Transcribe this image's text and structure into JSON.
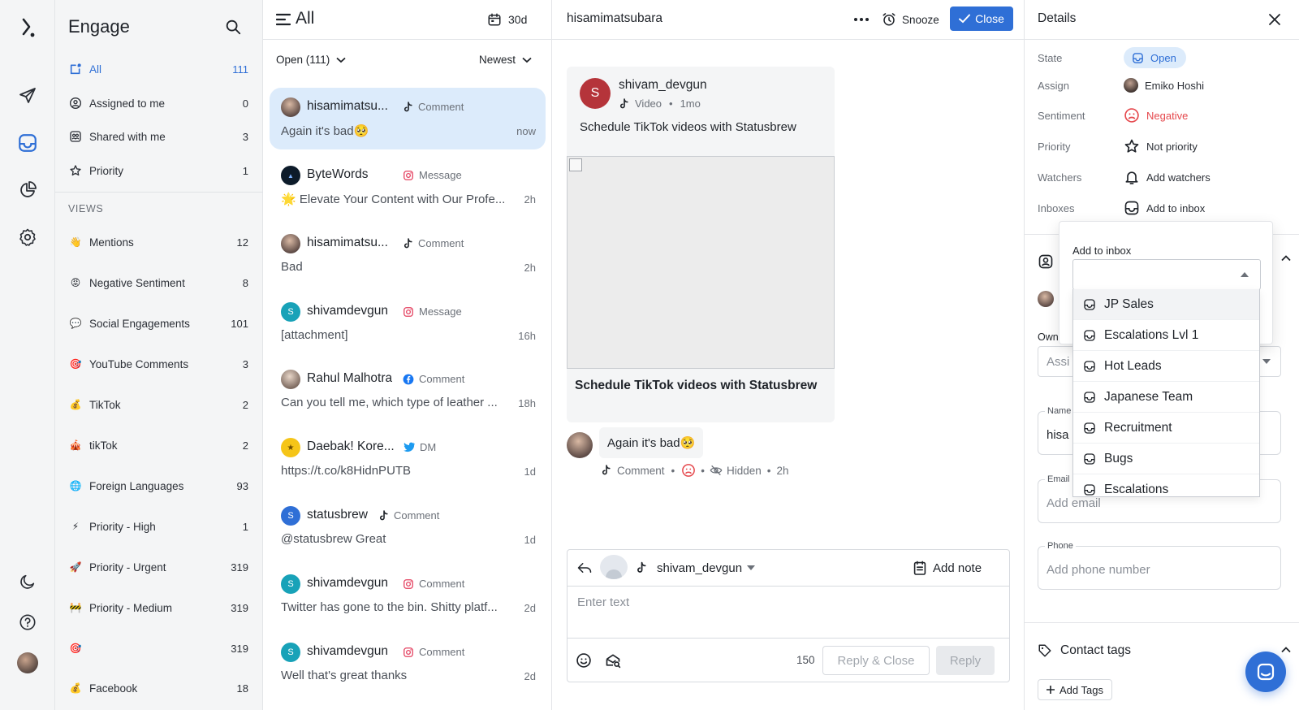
{
  "colors": {
    "accent": "#2f6fd6",
    "negative": "#e5484d",
    "open_bg": "#dcebfb"
  },
  "engage": {
    "title": "Engage",
    "items": [
      {
        "label": "All",
        "count": "111",
        "icon": "all-inbox-icon",
        "active": true
      },
      {
        "label": "Assigned to me",
        "count": "0",
        "icon": "user-circle-icon"
      },
      {
        "label": "Shared with me",
        "count": "3",
        "icon": "shared-icon"
      },
      {
        "label": "Priority",
        "count": "1",
        "icon": "star-icon"
      }
    ],
    "views_heading": "VIEWS",
    "views": [
      {
        "emoji": "👋",
        "label": "Mentions",
        "count": "12"
      },
      {
        "emoji": "😡",
        "label": "Negative Sentiment",
        "count": "8"
      },
      {
        "emoji": "💬",
        "label": "Social Engagements",
        "count": "101"
      },
      {
        "emoji": "🎯",
        "label": "YouTube Comments",
        "count": "3"
      },
      {
        "emoji": "💰",
        "label": "TikTok",
        "count": "2"
      },
      {
        "emoji": "🎪",
        "label": "tikTok",
        "count": "2"
      },
      {
        "emoji": "🌐",
        "label": "Foreign Languages",
        "count": "93"
      },
      {
        "emoji": "⚡",
        "label": "Priority - High",
        "count": "1"
      },
      {
        "emoji": "🚀",
        "label": "Priority - Urgent",
        "count": "319"
      },
      {
        "emoji": "🚧",
        "label": "Priority - Medium",
        "count": "319"
      },
      {
        "emoji": "🎯",
        "label": "",
        "count": "319"
      },
      {
        "emoji": "💰",
        "label": "Facebook",
        "count": "18"
      }
    ]
  },
  "list": {
    "title": "All",
    "range": "30d",
    "filter": "Open (111)",
    "sort": "Newest",
    "conversations": [
      {
        "name": "hisamimatsu...",
        "channel": "Comment",
        "network": "tiktok",
        "preview": "Again it's bad🥺",
        "time": "now",
        "avatar": "photo",
        "active": true
      },
      {
        "name": "ByteWords",
        "channel": "Message",
        "network": "instagram",
        "preview": "🌟 Elevate Your Content with Our Profe...",
        "time": "2h",
        "avatar": "dark"
      },
      {
        "name": "hisamimatsu...",
        "channel": "Comment",
        "network": "tiktok",
        "preview": "Bad",
        "time": "2h",
        "avatar": "photo"
      },
      {
        "name": "shivamdevgun",
        "channel": "Message",
        "network": "instagram",
        "preview": "[attachment]",
        "time": "16h",
        "avatar": "S",
        "avatar_color": "#18a2b8"
      },
      {
        "name": "Rahul Malhotra",
        "channel": "Comment",
        "network": "facebook",
        "preview": "Can you tell me, which type of leather ...",
        "time": "18h",
        "avatar": "photo2"
      },
      {
        "name": "Daebak! Kore...",
        "channel": "DM",
        "network": "twitter",
        "preview": "https://t.co/k8HidnPUTB",
        "time": "1d",
        "avatar": "yellow"
      },
      {
        "name": "statusbrew",
        "channel": "Comment",
        "network": "tiktok",
        "preview": "@statusbrew Great",
        "time": "1d",
        "avatar": "S",
        "avatar_color": "#2f6fd6"
      },
      {
        "name": "shivamdevgun",
        "channel": "Comment",
        "network": "instagram",
        "preview": "Twitter has gone to the bin. Shitty platf...",
        "time": "2d",
        "avatar": "S",
        "avatar_color": "#18a2b8"
      },
      {
        "name": "shivamdevgun",
        "channel": "Comment",
        "network": "instagram",
        "preview": "Well that's great thanks",
        "time": "2d",
        "avatar": "S",
        "avatar_color": "#18a2b8"
      }
    ]
  },
  "thread": {
    "title": "hisamimatsubara",
    "snooze_label": "Snooze",
    "close_label": "Close",
    "post": {
      "author": "shivam_devgun",
      "avatar_letter": "S",
      "type": "Video",
      "age": "1mo",
      "text": "Schedule TikTok videos with Statusbrew",
      "caption": "Schedule TikTok videos with Statusbrew"
    },
    "comment": {
      "text": "Again it's bad🥺",
      "channel": "Comment",
      "hidden_label": "Hidden",
      "time": "2h"
    },
    "composer": {
      "account": "shivam_devgun",
      "add_note": "Add note",
      "placeholder": "Enter text",
      "char_count": "150",
      "reply_close": "Reply & Close",
      "reply": "Reply"
    }
  },
  "details": {
    "title": "Details",
    "rows": [
      {
        "label": "State",
        "value": "Open"
      },
      {
        "label": "Assign",
        "value": "Emiko Hoshi"
      },
      {
        "label": "Sentiment",
        "value": "Negative"
      },
      {
        "label": "Priority",
        "value": "Not priority"
      },
      {
        "label": "Watchers",
        "value": "Add watchers"
      },
      {
        "label": "Inboxes",
        "value": "Add to inbox"
      }
    ],
    "owner_label_partial": "Own",
    "owner_placeholder_partial": "Assi",
    "name_label": "Name",
    "name_value_partial": "hisa",
    "email_label": "Email",
    "email_placeholder": "Add email",
    "phone_label": "Phone",
    "phone_placeholder": "Add phone number",
    "contact_tags": "Contact tags",
    "add_tags": "Add Tags"
  },
  "dropdown": {
    "label": "Add to inbox",
    "options": [
      "JP Sales",
      "Escalations Lvl 1",
      "Hot Leads",
      "Japanese Team",
      "Recruitment",
      "Bugs",
      "Escalations"
    ]
  }
}
